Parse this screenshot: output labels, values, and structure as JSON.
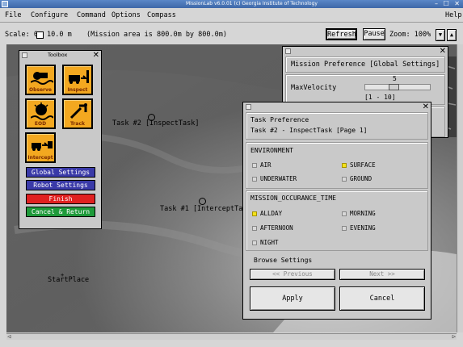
{
  "window": {
    "title": "MissionLab v6.0.01 (c) Georgia Institute of Technology"
  },
  "menu": {
    "file": "File",
    "configure": "Configure",
    "command": "Command",
    "options": "Options",
    "compass": "Compass",
    "help": "Help"
  },
  "status": {
    "scale_label": "Scale: 0",
    "scale_value": "10.0 m",
    "mission_area": "(Mission area is 800.0m by 800.0m)",
    "refresh": "Refresh",
    "pause": "Pause",
    "zoom": "Zoom: 100%"
  },
  "map": {
    "labels": {
      "task2": "Task #2 [InspectTask]",
      "task1": "Task #1 [InterceptTask",
      "start": "StartPlace"
    }
  },
  "toolbox": {
    "title": "Toolbox",
    "tools": [
      {
        "label": "Observe",
        "icon": "observe-icon"
      },
      {
        "label": "Inspect",
        "icon": "inspect-icon"
      },
      {
        "label": "EOD",
        "icon": "eod-icon"
      },
      {
        "label": "Track",
        "icon": "track-icon"
      },
      {
        "label": "Intercept",
        "icon": "intercept-icon"
      }
    ],
    "buttons": {
      "global": "Global Settings",
      "robot": "Robot Settings",
      "finish": "Finish",
      "cancel": "Cancel & Return"
    },
    "colors": {
      "global": "#3a3aa8",
      "robot": "#3a3aa8",
      "finish": "#e02020",
      "cancel": "#1e9a3a",
      "tool_bg": "#f3a820"
    }
  },
  "mission_pref": {
    "title": "Mission Preference [Global Settings]",
    "param_label": "MaxVelocity",
    "value": "5",
    "range": "[1 - 10]",
    "slider_fraction": 0.44
  },
  "task_pref": {
    "header1": "Task Preference",
    "header2": "Task #2 - InspectTask [Page 1]",
    "environment": {
      "title": "ENVIRONMENT",
      "options": [
        {
          "label": "AIR",
          "checked": false
        },
        {
          "label": "SURFACE",
          "checked": true
        },
        {
          "label": "UNDERWATER",
          "checked": false
        },
        {
          "label": "GROUND",
          "checked": false
        }
      ]
    },
    "occurrence": {
      "title": "MISSION_OCCURANCE_TIME",
      "options": [
        {
          "label": "ALLDAY",
          "checked": true
        },
        {
          "label": "MORNING",
          "checked": false
        },
        {
          "label": "AFTERNOON",
          "checked": false
        },
        {
          "label": "EVENING",
          "checked": false
        },
        {
          "label": "NIGHT",
          "checked": false
        }
      ]
    },
    "browse": {
      "title": "Browse Settings",
      "previous": "<< Previous",
      "next": "Next >>"
    },
    "apply": "Apply",
    "cancel": "Cancel"
  }
}
